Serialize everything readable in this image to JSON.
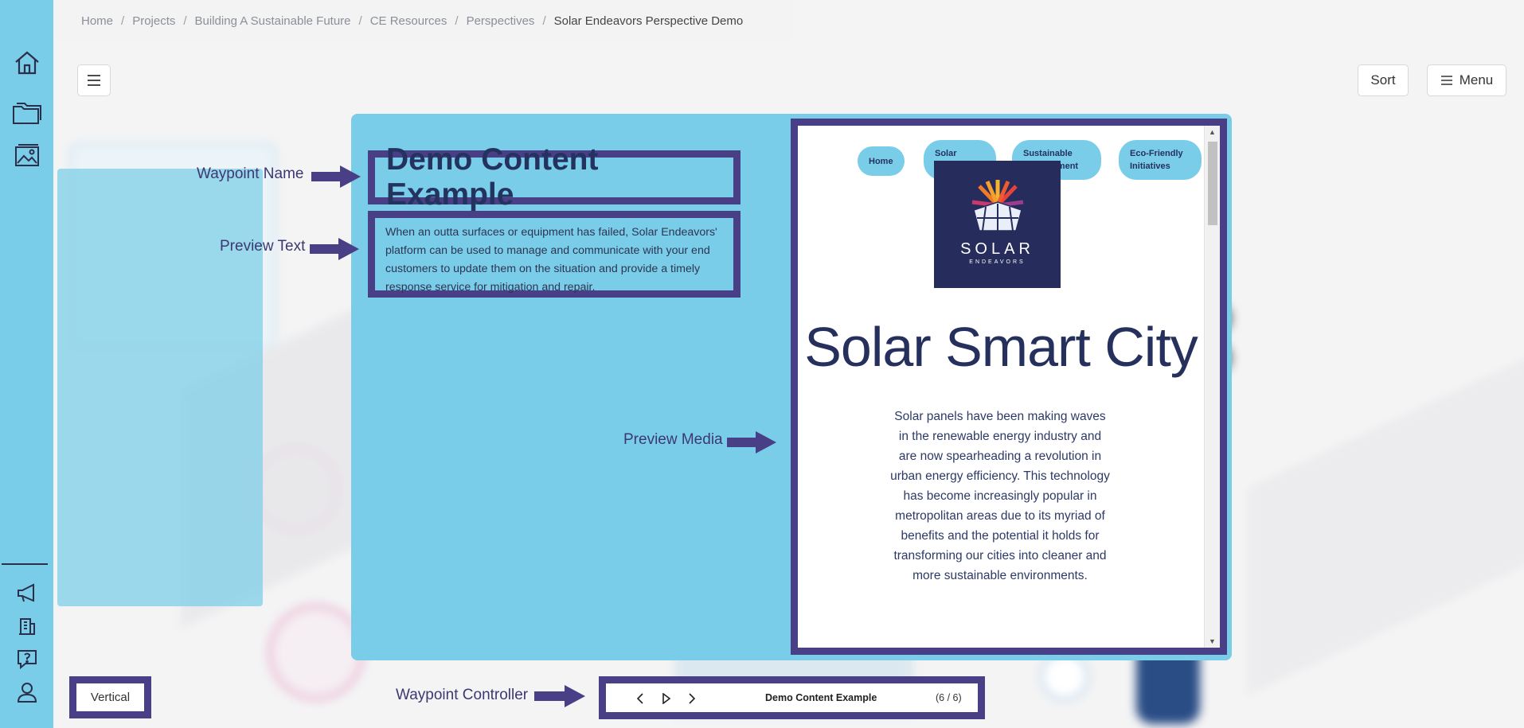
{
  "breadcrumb": [
    "Home",
    "Projects",
    "Building A Sustainable Future",
    "CE Resources",
    "Perspectives",
    "Solar Endeavors Perspective Demo"
  ],
  "toolbar": {
    "sort_label": "Sort",
    "menu_label": "Menu"
  },
  "sidebar": {
    "top_icons": [
      "home-icon",
      "folder-icon",
      "gallery-icon"
    ],
    "bottom_icons": [
      "megaphone-icon",
      "building-icon",
      "help-icon",
      "user-icon"
    ]
  },
  "annotations": {
    "waypoint_name": "Waypoint Name",
    "preview_text": "Preview Text",
    "preview_media": "Preview Media",
    "waypoint_controller": "Waypoint Controller"
  },
  "card": {
    "title": "Demo Content Example",
    "preview_text": "When an outta surfaces or equipment has failed, Solar Endeavors' platform can be used to manage and communicate with your end customers to update them on the situation and provide a timely response service for mitigation and repair."
  },
  "media": {
    "nav": [
      "Home",
      "Solar Integration",
      "Sustainable Development",
      "Eco-Friendly Initiatives"
    ],
    "logo_text": "SOLAR",
    "logo_sub": "ENDEAVORS",
    "heading": "Solar Smart City",
    "body": "Solar panels have been making waves in the renewable energy industry and are now spearheading a revolution in urban energy efficiency. This technology has become increasingly popular in metropolitan areas due to its myriad of benefits and the potential it holds for transforming our cities into cleaner and more sustainable environments."
  },
  "controls": {
    "orientation": "Vertical",
    "controller_title": "Demo Content Example",
    "controller_count": "(6 / 6)"
  },
  "colors": {
    "sidebar": "#7acde8",
    "frame": "#483f86",
    "title": "#24325f"
  }
}
